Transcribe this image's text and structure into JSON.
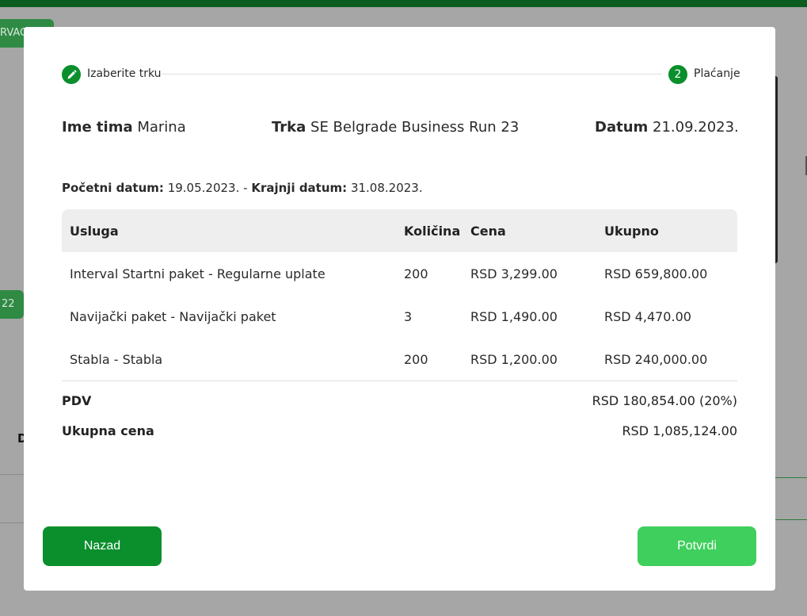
{
  "background": {
    "top_button_label": "RVAC",
    "side_button_label": "22",
    "side_letter": "D"
  },
  "stepper": {
    "step1_label": "Izaberite trku",
    "step2_number": "2",
    "step2_label": "Plaćanje"
  },
  "info": {
    "team_label": "Ime tima",
    "team_value": "Marina",
    "race_label": "Trka",
    "race_value": "SE Belgrade Business Run 23",
    "date_label": "Datum",
    "date_value": "21.09.2023."
  },
  "dates": {
    "start_label": "Početni datum:",
    "start_value": "19.05.2023.",
    "separator": "-",
    "end_label": "Krajnji datum:",
    "end_value": "31.08.2023."
  },
  "table": {
    "headers": [
      "Usluga",
      "Količina",
      "Cena",
      "Ukupno"
    ],
    "rows": [
      [
        "Interval Startni paket - Regularne uplate",
        "200",
        "RSD 3,299.00",
        "RSD 659,800.00"
      ],
      [
        "Navijački paket - Navijački paket",
        "3",
        "RSD 1,490.00",
        "RSD 4,470.00"
      ],
      [
        "Stabla - Stabla",
        "200",
        "RSD 1,200.00",
        "RSD 240,000.00"
      ]
    ]
  },
  "summary": {
    "pdv_label": "PDV",
    "pdv_value": "RSD 180,854.00 (20%)",
    "total_label": "Ukupna cena",
    "total_value": "RSD 1,085,124.00"
  },
  "buttons": {
    "back_label": "Nazad",
    "confirm_label": "Potvrdi"
  },
  "colors": {
    "primary_green": "#0a8f2c",
    "confirm_green": "#3fcf5c"
  }
}
